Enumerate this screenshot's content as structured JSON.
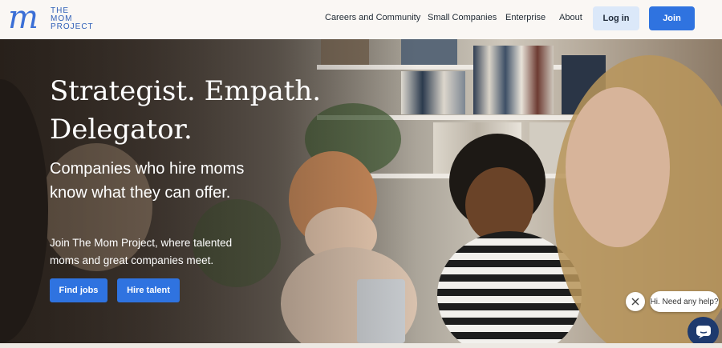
{
  "brand": {
    "mark": "m",
    "line1": "THE",
    "line2": "MOM",
    "line3": "PROJECT"
  },
  "nav": {
    "items": [
      {
        "label": "Careers and Community"
      },
      {
        "label": "Small Companies"
      },
      {
        "label": "Enterprise"
      },
      {
        "label": "About"
      }
    ],
    "login_label": "Log in",
    "join_label": "Join"
  },
  "hero": {
    "headline_line1": "Strategist. Empath.",
    "headline_line2": "Delegator.",
    "subhead_line1": "Companies who hire moms",
    "subhead_line2": "know what they can offer.",
    "body_line1": "Join The Mom Project, where talented",
    "body_line2": "moms and great companies meet.",
    "find_jobs_label": "Find jobs",
    "hire_talent_label": "Hire talent"
  },
  "chat": {
    "prompt": "Hi. Need any help?",
    "close_icon": "close-icon",
    "launcher_icon": "chat-icon"
  },
  "colors": {
    "accent": "#2f73e0",
    "login_bg": "#dbe8f9",
    "brand": "#3b6fd6",
    "chat_launcher": "#1e3a6e"
  }
}
